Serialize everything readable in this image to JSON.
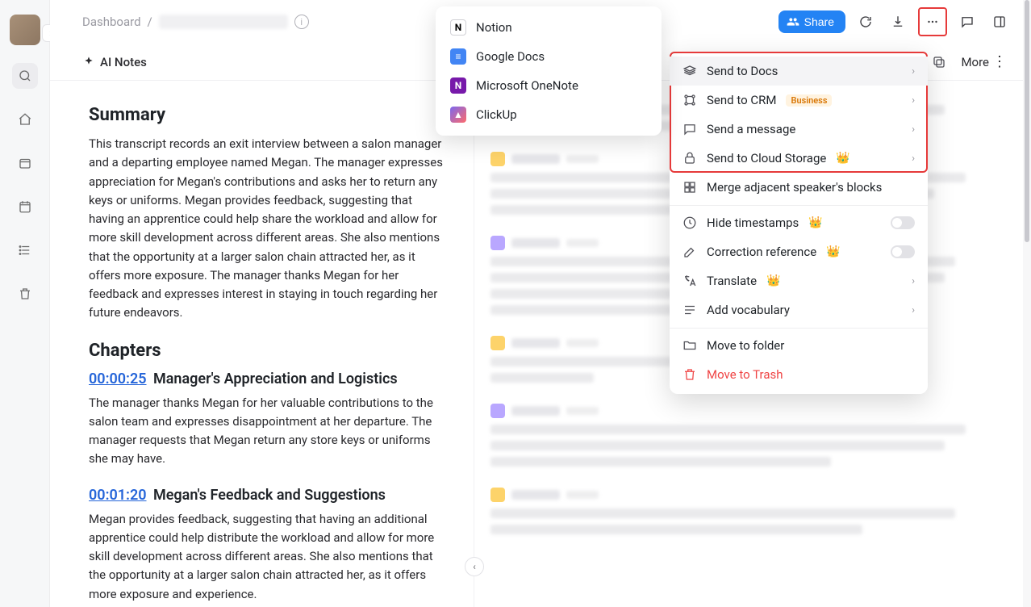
{
  "sidebar": {},
  "topbar": {
    "breadcrumb_root": "Dashboard",
    "breadcrumb_sep": "/",
    "share_label": "Share"
  },
  "secondbar": {
    "ai_notes_label": "AI Notes",
    "more_label": "More"
  },
  "summary": {
    "heading": "Summary",
    "body": "This transcript records an exit interview between a salon manager and a departing employee named Megan. The manager expresses appreciation for Megan's contributions and asks her to return any keys or uniforms. Megan provides feedback, suggesting that having an apprentice could help share the workload and allow for more skill development across different areas. She also mentions that the opportunity at a larger salon chain attracted her, as it offers more exposure. The manager thanks Megan for her feedback and expresses interest in staying in touch regarding her future endeavors."
  },
  "chapters": {
    "heading": "Chapters",
    "items": [
      {
        "ts": "00:00:25",
        "title": "Manager's Appreciation and Logistics",
        "body": "The manager thanks Megan for her valuable contributions to the salon team and expresses disappointment at her departure. The manager requests that Megan return any store keys or uniforms she may have."
      },
      {
        "ts": "00:01:20",
        "title": "Megan's Feedback and Suggestions",
        "body": "Megan provides feedback, suggesting that having an additional apprentice could help distribute the workload and allow for more skill development across different areas. She also mentions that the opportunity at a larger salon chain attracted her, as it offers more exposure and experience."
      }
    ]
  },
  "docs_submenu": {
    "items": [
      {
        "label": "Notion",
        "ico": "N",
        "cls": "notion"
      },
      {
        "label": "Google Docs",
        "ico": "≡",
        "cls": "gdocs"
      },
      {
        "label": "Microsoft OneNote",
        "ico": "N",
        "cls": "onenote"
      },
      {
        "label": "ClickUp",
        "ico": "▲",
        "cls": "clickup"
      }
    ]
  },
  "ctx": {
    "send_docs": "Send to Docs",
    "send_crm": "Send to CRM",
    "crm_badge": "Business",
    "send_msg": "Send a message",
    "send_cloud": "Send to Cloud Storage",
    "merge": "Merge adjacent speaker's blocks",
    "hide_ts": "Hide timestamps",
    "corr_ref": "Correction reference",
    "translate": "Translate",
    "add_vocab": "Add vocabulary",
    "move_folder": "Move to folder",
    "move_trash": "Move to Trash"
  }
}
